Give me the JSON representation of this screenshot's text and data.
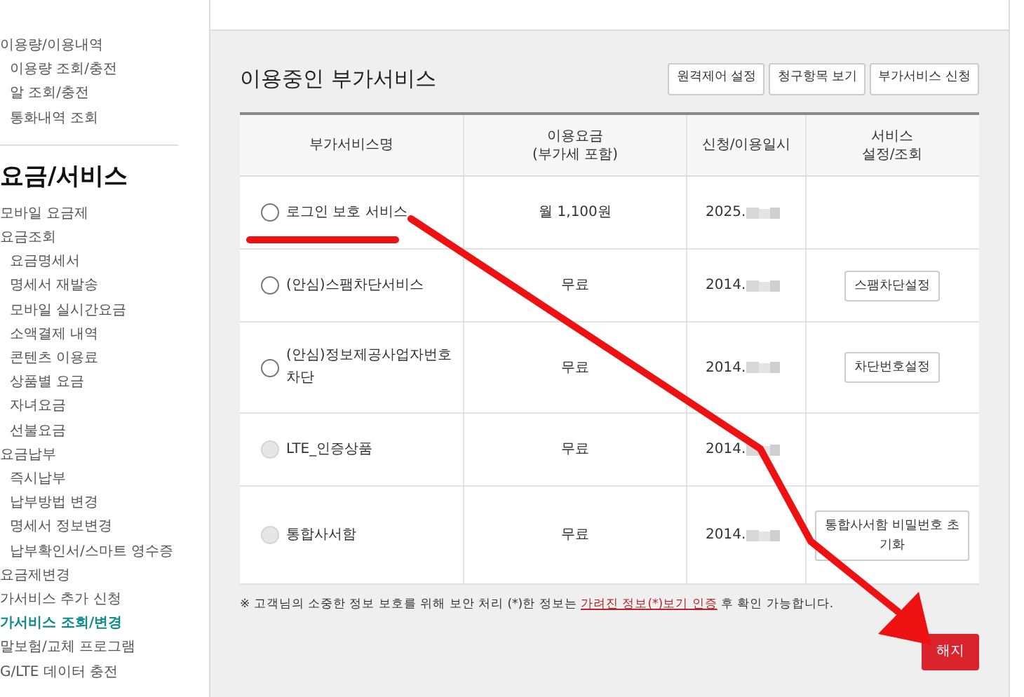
{
  "sidebar": {
    "groups": [
      {
        "items": [
          {
            "label": "이용량/이용내역",
            "kind": "main",
            "selected": false
          },
          {
            "label": "이용량 조회/충전",
            "kind": "sub",
            "selected": false
          },
          {
            "label": "알 조회/충전",
            "kind": "sub",
            "selected": false
          },
          {
            "label": "통화내역 조회",
            "kind": "sub",
            "selected": false
          }
        ]
      },
      {
        "heading": "요금/서비스",
        "items": [
          {
            "label": "모바일 요금제",
            "kind": "main",
            "selected": false
          },
          {
            "label": "요금조회",
            "kind": "main",
            "selected": false
          },
          {
            "label": "요금명세서",
            "kind": "sub",
            "selected": false
          },
          {
            "label": "명세서 재발송",
            "kind": "sub",
            "selected": false
          },
          {
            "label": "모바일 실시간요금",
            "kind": "sub",
            "selected": false
          },
          {
            "label": "소액결제 내역",
            "kind": "sub",
            "selected": false
          },
          {
            "label": "콘텐츠 이용료",
            "kind": "sub",
            "selected": false
          },
          {
            "label": "상품별 요금",
            "kind": "sub",
            "selected": false
          },
          {
            "label": "자녀요금",
            "kind": "sub",
            "selected": false
          },
          {
            "label": "선불요금",
            "kind": "sub",
            "selected": false
          },
          {
            "label": "요금납부",
            "kind": "main",
            "selected": false
          },
          {
            "label": "즉시납부",
            "kind": "sub",
            "selected": false
          },
          {
            "label": "납부방법 변경",
            "kind": "sub",
            "selected": false
          },
          {
            "label": "명세서 정보변경",
            "kind": "sub",
            "selected": false
          },
          {
            "label": "납부확인서/스마트 영수증",
            "kind": "sub",
            "selected": false
          },
          {
            "label": "요금제변경",
            "kind": "main",
            "selected": false
          },
          {
            "label": "가서비스 추가 신청",
            "kind": "main",
            "selected": false
          },
          {
            "label": "가서비스 조회/변경",
            "kind": "main",
            "selected": true
          },
          {
            "label": "말보험/교체 프로그램",
            "kind": "main",
            "selected": false
          },
          {
            "label": "G/LTE 데이터 충전",
            "kind": "main",
            "selected": false
          }
        ]
      }
    ]
  },
  "section": {
    "title": "이용중인 부가서비스",
    "actions": [
      "원격제어 설정",
      "청구항목 보기",
      "부가서비스 신청"
    ]
  },
  "table": {
    "columns": [
      "부가서비스명",
      "이용요금\n(부가세 포함)",
      "신청/이용일시",
      "서비스\n설정/조회"
    ],
    "rows": [
      {
        "name": "로그인 보호 서비스",
        "fee": "월 1,100원",
        "date": "2025.",
        "action": null,
        "disabled": false,
        "selected": false
      },
      {
        "name": "(안심)스팸차단서비스",
        "fee": "무료",
        "date": "2014.",
        "action": "스팸차단설정",
        "disabled": false,
        "selected": false
      },
      {
        "name": "(안심)정보제공사업자번호차단",
        "fee": "무료",
        "date": "2014.",
        "action": "차단번호설정",
        "disabled": false,
        "selected": false
      },
      {
        "name": "LTE_인증상품",
        "fee": "무료",
        "date": "2014.",
        "action": null,
        "disabled": true,
        "selected": false
      },
      {
        "name": "통합사서함",
        "fee": "무료",
        "date": "2014.",
        "action": "통합사서함 비밀번호 초기화",
        "disabled": true,
        "selected": false
      }
    ]
  },
  "notice": {
    "before": "※ 고객님의 소중한 정보 보호를 위해 보안 처리 (*)한 정보는 ",
    "link": "가려진 정보(*)보기 인증",
    "after": " 후 확인 가능합니다."
  },
  "cancel_button": "해지"
}
